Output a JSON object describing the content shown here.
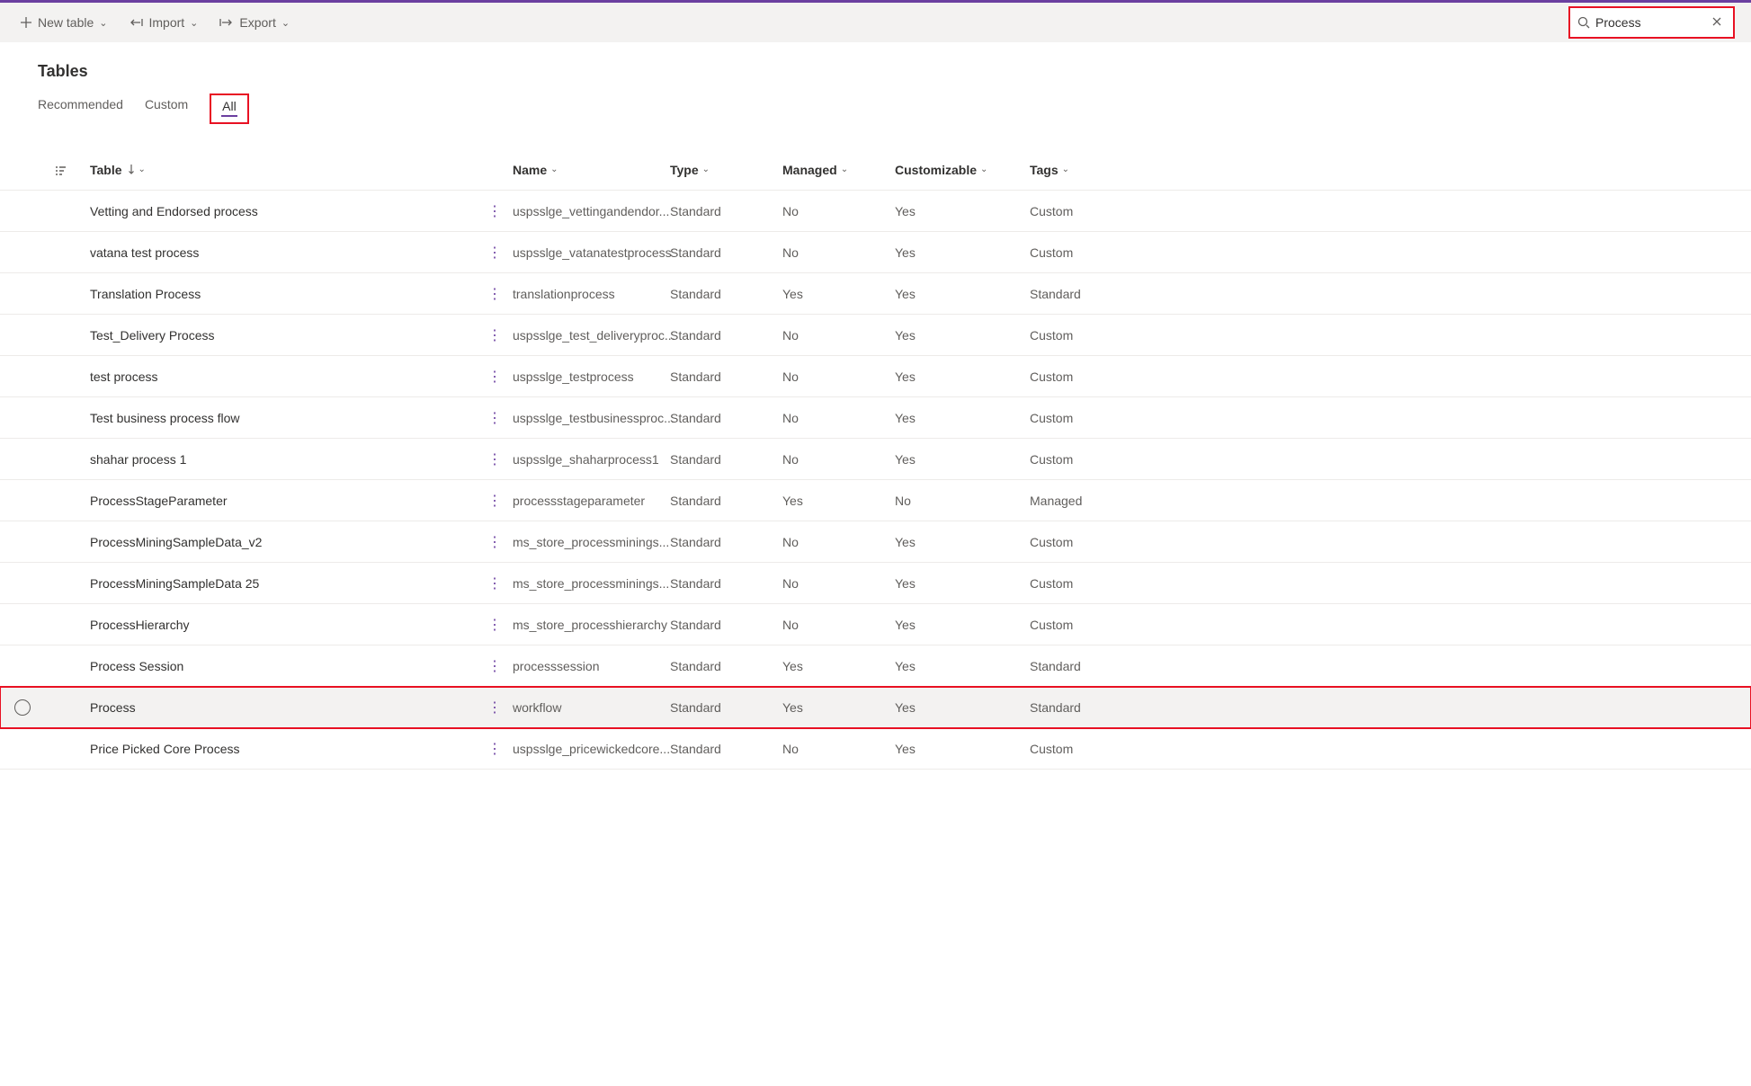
{
  "commandBar": {
    "newTable": "New table",
    "import": "Import",
    "export": "Export"
  },
  "search": {
    "value": "Process"
  },
  "pageTitle": "Tables",
  "tabs": {
    "recommended": "Recommended",
    "custom": "Custom",
    "all": "All"
  },
  "columns": {
    "table": "Table",
    "name": "Name",
    "type": "Type",
    "managed": "Managed",
    "customizable": "Customizable",
    "tags": "Tags"
  },
  "rows": [
    {
      "table": "Vetting and Endorsed process",
      "name": "uspsslge_vettingandendor...",
      "type": "Standard",
      "managed": "No",
      "customizable": "Yes",
      "tags": "Custom"
    },
    {
      "table": "vatana test process",
      "name": "uspsslge_vatanatestprocess",
      "type": "Standard",
      "managed": "No",
      "customizable": "Yes",
      "tags": "Custom"
    },
    {
      "table": "Translation Process",
      "name": "translationprocess",
      "type": "Standard",
      "managed": "Yes",
      "customizable": "Yes",
      "tags": "Standard"
    },
    {
      "table": "Test_Delivery Process",
      "name": "uspsslge_test_deliveryproc...",
      "type": "Standard",
      "managed": "No",
      "customizable": "Yes",
      "tags": "Custom"
    },
    {
      "table": "test process",
      "name": "uspsslge_testprocess",
      "type": "Standard",
      "managed": "No",
      "customizable": "Yes",
      "tags": "Custom"
    },
    {
      "table": "Test business process flow",
      "name": "uspsslge_testbusinessproc...",
      "type": "Standard",
      "managed": "No",
      "customizable": "Yes",
      "tags": "Custom"
    },
    {
      "table": "shahar process 1",
      "name": "uspsslge_shaharprocess1",
      "type": "Standard",
      "managed": "No",
      "customizable": "Yes",
      "tags": "Custom"
    },
    {
      "table": "ProcessStageParameter",
      "name": "processstageparameter",
      "type": "Standard",
      "managed": "Yes",
      "customizable": "No",
      "tags": "Managed"
    },
    {
      "table": "ProcessMiningSampleData_v2",
      "name": "ms_store_processminings...",
      "type": "Standard",
      "managed": "No",
      "customizable": "Yes",
      "tags": "Custom"
    },
    {
      "table": "ProcessMiningSampleData 25",
      "name": "ms_store_processminings...",
      "type": "Standard",
      "managed": "No",
      "customizable": "Yes",
      "tags": "Custom"
    },
    {
      "table": "ProcessHierarchy",
      "name": "ms_store_processhierarchy",
      "type": "Standard",
      "managed": "No",
      "customizable": "Yes",
      "tags": "Custom"
    },
    {
      "table": "Process Session",
      "name": "processsession",
      "type": "Standard",
      "managed": "Yes",
      "customizable": "Yes",
      "tags": "Standard"
    },
    {
      "table": "Process",
      "name": "workflow",
      "type": "Standard",
      "managed": "Yes",
      "customizable": "Yes",
      "tags": "Standard",
      "highlighted": true
    },
    {
      "table": "Price Picked Core Process",
      "name": "uspsslge_pricewickedcore...",
      "type": "Standard",
      "managed": "No",
      "customizable": "Yes",
      "tags": "Custom"
    }
  ]
}
